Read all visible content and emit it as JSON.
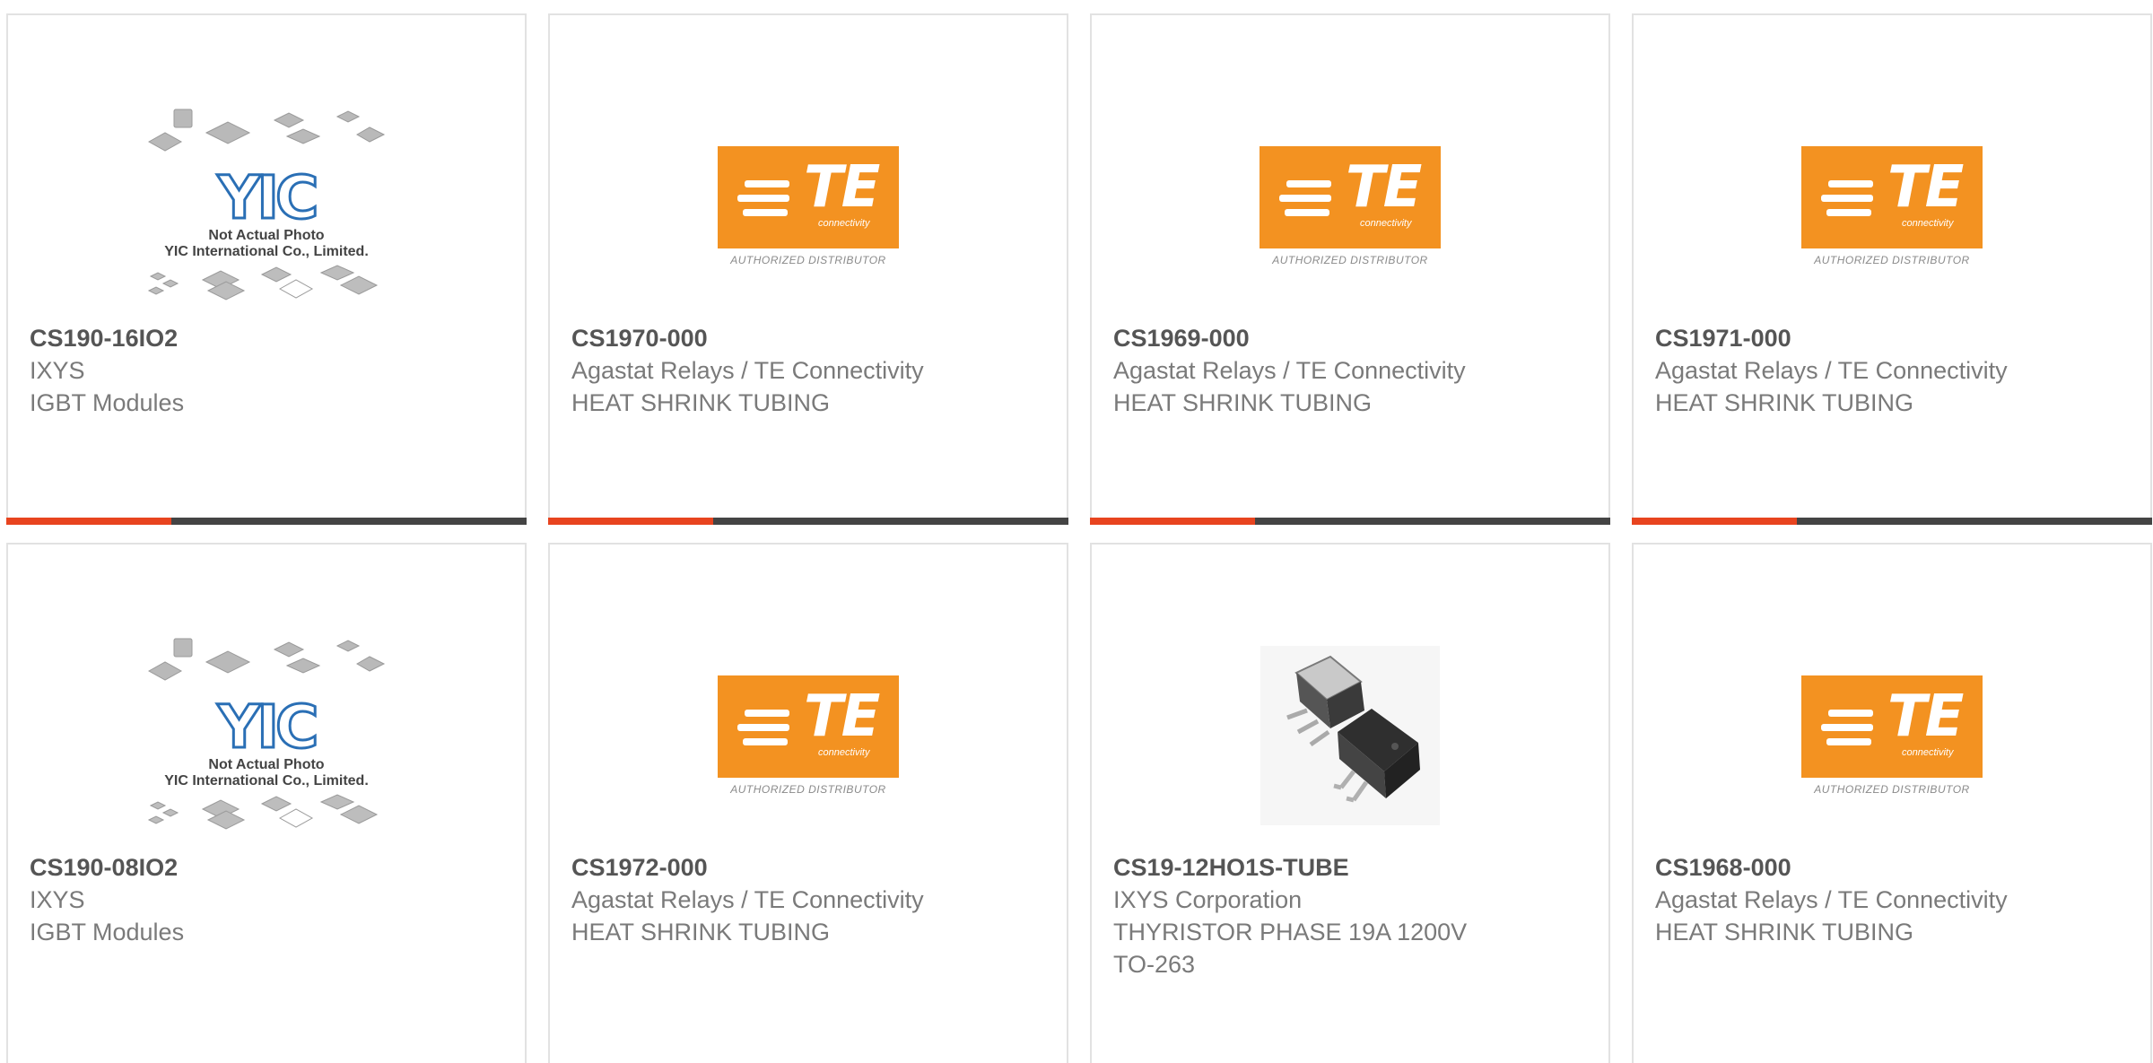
{
  "images": {
    "te_logo": {
      "brand_text": "TE",
      "tagline": "connectivity",
      "distributor_text": "AUTHORIZED DISTRIBUTOR"
    },
    "yic_placeholder": {
      "logo_text": "YIC",
      "note_line1": "Not Actual Photo",
      "note_line2": "YIC International Co., Limited."
    }
  },
  "colors": {
    "accent": "#e8441f",
    "bar": "#444444",
    "te_orange": "#f39221",
    "yic_blue": "#2a6fb5"
  },
  "products": [
    {
      "part_number": "CS190-16IO2",
      "manufacturer": "IXYS",
      "desc1": "IGBT Modules",
      "desc2": "",
      "image": "yic-placeholder"
    },
    {
      "part_number": "CS1970-000",
      "manufacturer": "Agastat Relays / TE Connectivity",
      "desc1": "HEAT SHRINK TUBING",
      "desc2": "",
      "image": "te-logo"
    },
    {
      "part_number": "CS1969-000",
      "manufacturer": "Agastat Relays / TE Connectivity",
      "desc1": "HEAT SHRINK TUBING",
      "desc2": "",
      "image": "te-logo"
    },
    {
      "part_number": "CS1971-000",
      "manufacturer": "Agastat Relays / TE Connectivity",
      "desc1": "HEAT SHRINK TUBING",
      "desc2": "",
      "image": "te-logo"
    },
    {
      "part_number": "CS190-08IO2",
      "manufacturer": "IXYS",
      "desc1": "IGBT Modules",
      "desc2": "",
      "image": "yic-placeholder"
    },
    {
      "part_number": "CS1972-000",
      "manufacturer": "Agastat Relays / TE Connectivity",
      "desc1": "HEAT SHRINK TUBING",
      "desc2": "",
      "image": "te-logo"
    },
    {
      "part_number": "CS19-12HO1S-TUBE",
      "manufacturer": "IXYS Corporation",
      "desc1": "THYRISTOR PHASE 19A 1200V",
      "desc2": "TO-263",
      "image": "to263-package"
    },
    {
      "part_number": "CS1968-000",
      "manufacturer": "Agastat Relays / TE Connectivity",
      "desc1": "HEAT SHRINK TUBING",
      "desc2": "",
      "image": "te-logo"
    }
  ]
}
